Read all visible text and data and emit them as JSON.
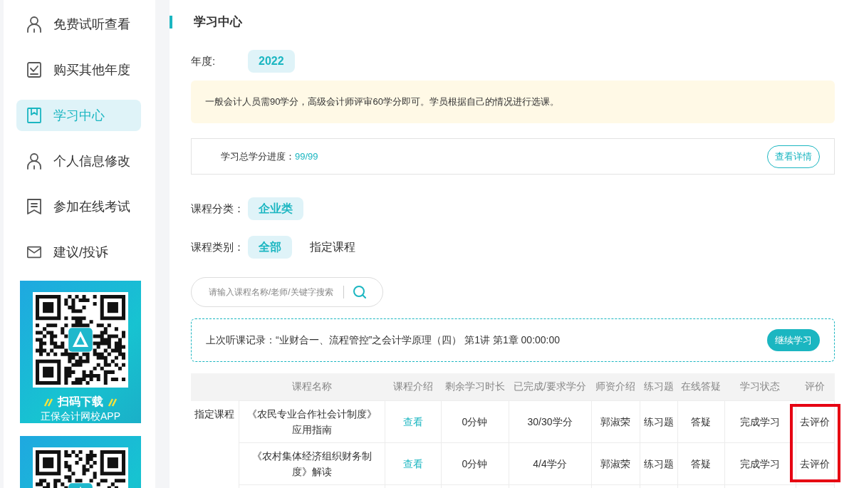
{
  "sidebar": {
    "items": [
      {
        "label": "免费试听查看",
        "selected": false
      },
      {
        "label": "购买其他年度",
        "selected": false
      },
      {
        "label": "学习中心",
        "selected": true
      },
      {
        "label": "个人信息修改",
        "selected": false
      },
      {
        "label": "参加在线考试",
        "selected": false
      },
      {
        "label": "建议/投诉",
        "selected": false
      }
    ],
    "promos": [
      {
        "kind": "qr_card",
        "title": "扫码下载",
        "subtitle": "正保会计网校APP"
      },
      {
        "kind": "qr_card"
      }
    ]
  },
  "page_title": "学习中心",
  "year": {
    "label": "年度:",
    "options": [
      {
        "label": "2022",
        "selected": true
      }
    ]
  },
  "notice": "一般会计人员需90学分，高级会计师评审60学分即可。学员根据自己的情况进行选课。",
  "progress": {
    "label": "学习总学分进度：",
    "value": "99/99",
    "button": "查看详情"
  },
  "category": {
    "label": "课程分类：",
    "options": [
      {
        "label": "企业类",
        "selected": true
      }
    ]
  },
  "course_type": {
    "label": "课程类别：",
    "options": [
      {
        "label": "全部",
        "selected": true
      },
      {
        "label": "指定课程",
        "selected": false
      }
    ]
  },
  "search": {
    "placeholder": "请输入课程名称/老师/关键字搜索"
  },
  "last_record": {
    "text": "上次听课记录：“业财合一、流程管控”之会计学原理（四） 第1讲 第1章 00:00:00",
    "button": "继续学习"
  },
  "table": {
    "columns": [
      {
        "highlighted": false
      },
      {
        "label": "课程名称",
        "highlighted": false
      },
      {
        "label": "课程介绍",
        "highlighted": false
      },
      {
        "label": "剩余学习时长",
        "highlighted": false
      },
      {
        "label": "已完成/要求学分",
        "highlighted": false
      },
      {
        "label": "师资介绍",
        "highlighted": false
      },
      {
        "label": "练习题",
        "highlighted": false
      },
      {
        "label": "在线答疑",
        "highlighted": false
      },
      {
        "label": "学习状态",
        "highlighted": false
      },
      {
        "label": "评价",
        "highlighted": true
      }
    ],
    "groups": [
      {
        "label": "指定课程",
        "rows": [
          {
            "name": "《农民专业合作社会计制度》应用指南",
            "intro": "查看",
            "remaining": "0分钟",
            "credits": "30/30学分",
            "teacher": "郭淑荣",
            "exercise": "练习题",
            "qa": "答疑",
            "status": "完成学习",
            "review": "去评价"
          },
          {
            "name": "《农村集体经济组织财务制度》解读",
            "intro": "查看",
            "remaining": "0分钟",
            "credits": "4/4学分",
            "teacher": "郭淑荣",
            "exercise": "练习题",
            "qa": "答疑",
            "status": "完成学习",
            "review": "去评价"
          }
        ]
      }
    ]
  }
}
